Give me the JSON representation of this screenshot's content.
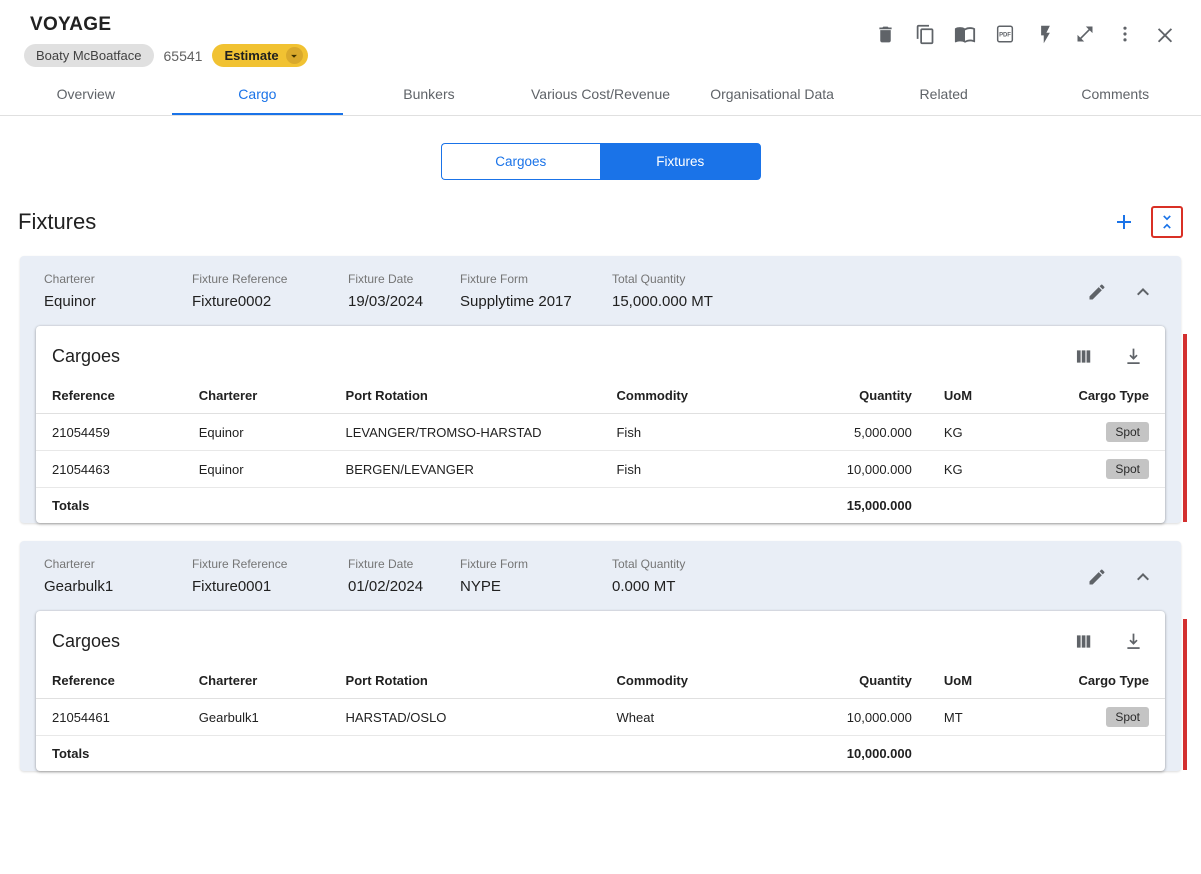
{
  "window": {
    "title": "VOYAGE",
    "vessel": "Boaty McBoatface",
    "voyage_number": "65541",
    "status": "Estimate"
  },
  "icons": {
    "pdf_label": "PDF",
    "toolbar": [
      "delete",
      "copy",
      "book",
      "pdf",
      "bolt",
      "expand",
      "kebab-menu",
      "close"
    ]
  },
  "tabs": {
    "active": "Cargo",
    "items": [
      {
        "label": "Overview"
      },
      {
        "label": "Cargo"
      },
      {
        "label": "Bunkers"
      },
      {
        "label": "Various Cost/Revenue"
      },
      {
        "label": "Organisational Data"
      },
      {
        "label": "Related"
      },
      {
        "label": "Comments"
      }
    ]
  },
  "view_toggle": {
    "cargoes_label": "Cargoes",
    "fixtures_label": "Fixtures",
    "selected": "Fixtures"
  },
  "section": {
    "title": "Fixtures"
  },
  "field_labels": {
    "charterer": "Charterer",
    "fixture_reference": "Fixture Reference",
    "fixture_date": "Fixture Date",
    "fixture_form": "Fixture Form",
    "total_quantity": "Total Quantity"
  },
  "cargoes_card": {
    "title": "Cargoes",
    "columns": {
      "reference": "Reference",
      "charterer": "Charterer",
      "port_rotation": "Port Rotation",
      "commodity": "Commodity",
      "quantity": "Quantity",
      "uom": "UoM",
      "cargo_type": "Cargo Type"
    },
    "totals_label": "Totals"
  },
  "fixtures": [
    {
      "charterer": "Equinor",
      "fixture_reference": "Fixture0002",
      "fixture_date": "19/03/2024",
      "fixture_form": "Supplytime 2017",
      "total_quantity": "15,000.000 MT",
      "rows": [
        {
          "reference": "21054459",
          "charterer": "Equinor",
          "port_rotation": "LEVANGER/TROMSO-HARSTAD",
          "commodity": "Fish",
          "quantity": "5,000.000",
          "uom": "KG",
          "cargo_type": "Spot"
        },
        {
          "reference": "21054463",
          "charterer": "Equinor",
          "port_rotation": "BERGEN/LEVANGER",
          "commodity": "Fish",
          "quantity": "10,000.000",
          "uom": "KG",
          "cargo_type": "Spot"
        }
      ],
      "total": "15,000.000"
    },
    {
      "charterer": "Gearbulk1",
      "fixture_reference": "Fixture0001",
      "fixture_date": "01/02/2024",
      "fixture_form": "NYPE",
      "total_quantity": "0.000 MT",
      "rows": [
        {
          "reference": "21054461",
          "charterer": "Gearbulk1",
          "port_rotation": "HARSTAD/OSLO",
          "commodity": "Wheat",
          "quantity": "10,000.000",
          "uom": "MT",
          "cargo_type": "Spot"
        }
      ],
      "total": "10,000.000"
    }
  ],
  "colors": {
    "accent_blue": "#1a73e8",
    "estimate_amber": "#f1c232",
    "card_header_bg": "#e9eef6",
    "red_accent": "#d32f2f",
    "highlight_outline": "#d93025"
  }
}
